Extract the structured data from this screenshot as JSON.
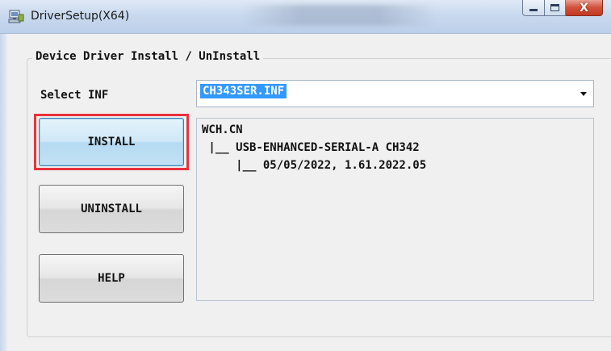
{
  "window": {
    "title": "DriverSetup(X64)",
    "icon": "driver-setup-icon",
    "controls": {
      "minimize_icon": "minimize-icon",
      "maximize_icon": "maximize-icon",
      "close_label": "X"
    }
  },
  "group": {
    "legend": "Device Driver Install / UnInstall"
  },
  "select_inf": {
    "label": "Select INF",
    "value": "CH343SER.INF",
    "selection_color": "#3399ff"
  },
  "buttons": {
    "install": "INSTALL",
    "uninstall": "UNINSTALL",
    "help": "HELP"
  },
  "info": {
    "lines": [
      "WCH.CN",
      " |__ USB-ENHANCED-SERIAL-A CH342",
      "     |__ 05/05/2022, 1.61.2022.05"
    ]
  },
  "annotation": {
    "highlight_color": "#e8323c"
  }
}
